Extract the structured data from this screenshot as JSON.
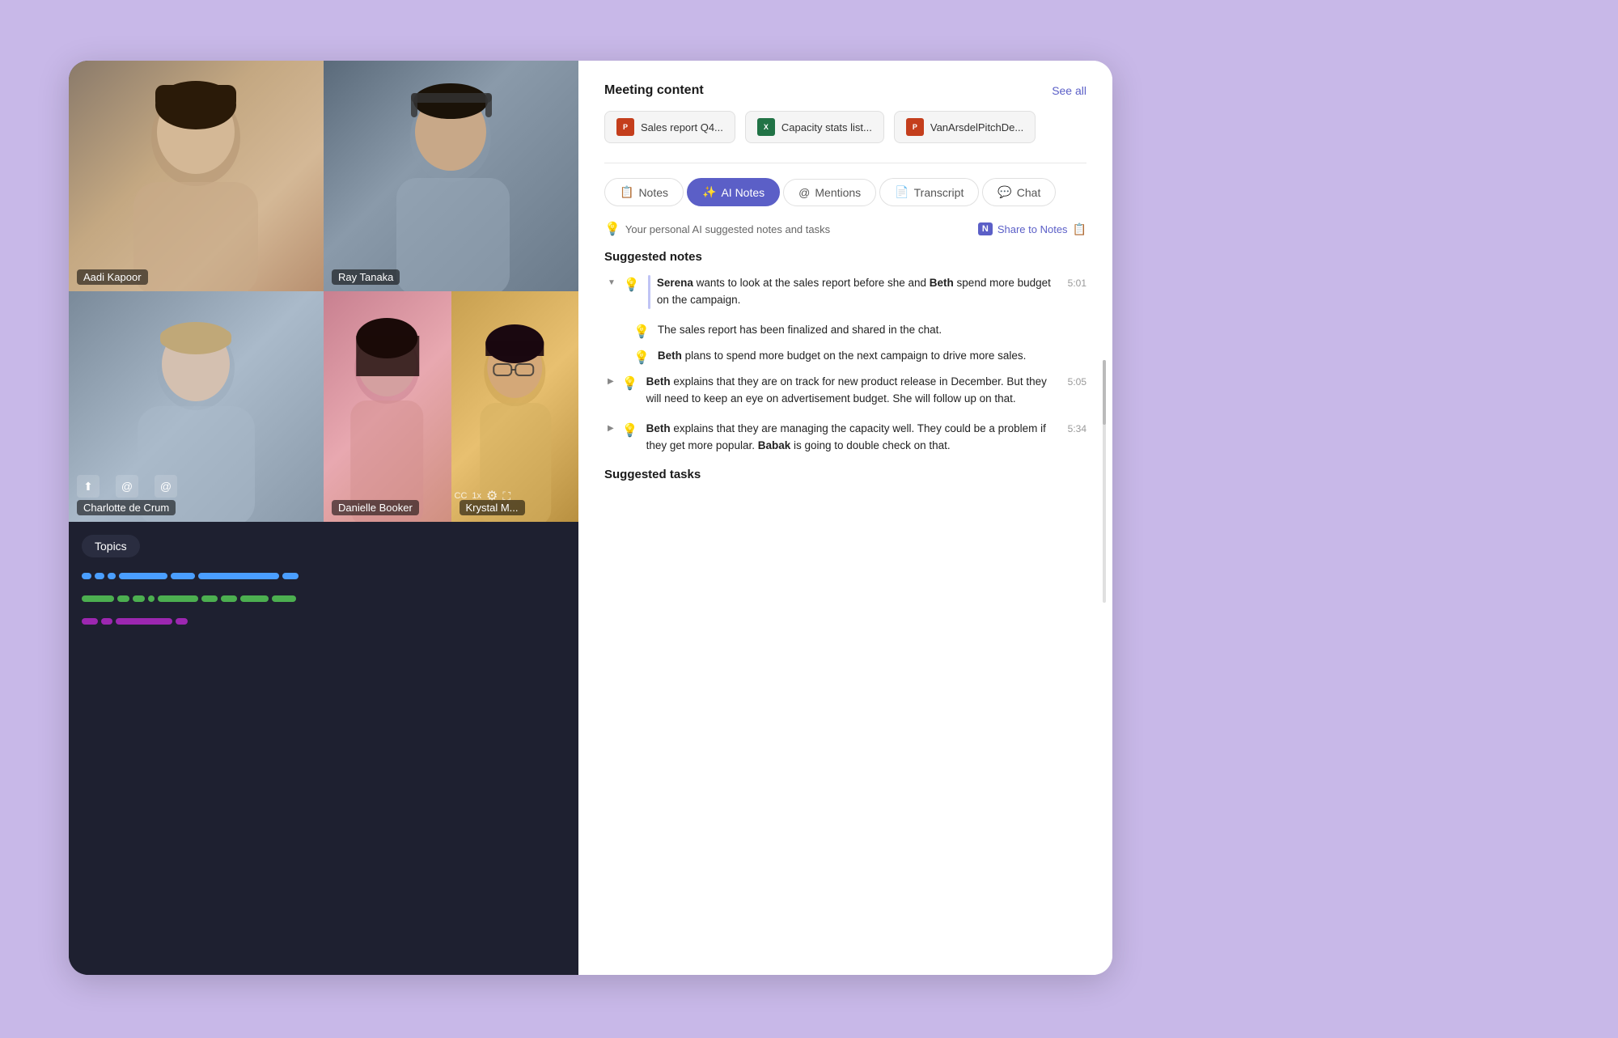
{
  "background": {
    "accent_color": "#c8b8e8"
  },
  "header": {
    "meeting_content_title": "Meeting content",
    "see_all_label": "See all"
  },
  "files": [
    {
      "id": "file-1",
      "icon_type": "ppt",
      "icon_label": "P",
      "name": "Sales report Q4...",
      "color": "#c43e1c"
    },
    {
      "id": "file-2",
      "icon_type": "xls",
      "icon_label": "X",
      "name": "Capacity stats list...",
      "color": "#217346"
    },
    {
      "id": "file-3",
      "icon_type": "ppt",
      "icon_label": "P",
      "name": "VanArsdelPitchDe...",
      "color": "#c43e1c"
    }
  ],
  "tabs": [
    {
      "id": "notes",
      "label": "Notes",
      "icon": "📋",
      "active": false
    },
    {
      "id": "ai-notes",
      "label": "AI Notes",
      "icon": "✨",
      "active": true
    },
    {
      "id": "mentions",
      "label": "Mentions",
      "icon": "@",
      "active": false
    },
    {
      "id": "transcript",
      "label": "Transcript",
      "icon": "📄",
      "active": false
    },
    {
      "id": "chat",
      "label": "Chat",
      "icon": "💬",
      "active": false
    }
  ],
  "ai_notes_panel": {
    "hint_text": "Your personal AI suggested notes and tasks",
    "share_label": "Share to Notes",
    "sections": [
      {
        "id": "suggested-notes",
        "title": "Suggested notes",
        "items": [
          {
            "id": "note-1",
            "expanded": true,
            "has_border": true,
            "text_html": "<strong>Serena</strong> wants to look at the sales report before she and <strong>Beth</strong> spend more budget on the campaign.",
            "time": "5:01",
            "children": [
              {
                "id": "note-1-1",
                "text_html": "The sales report has been finalized and shared in the chat."
              },
              {
                "id": "note-1-2",
                "text_html": "<strong>Beth</strong> plans to spend more budget on the next campaign to drive more sales."
              }
            ]
          },
          {
            "id": "note-2",
            "expanded": false,
            "text_html": "<strong>Beth</strong> explains that they are on track for new product release in December. But they will need to keep an eye on advertisement budget. She will follow up on that.",
            "time": "5:05"
          },
          {
            "id": "note-3",
            "expanded": false,
            "text_html": "<strong>Beth</strong> explains that they are managing the capacity well. They could be a problem if they get more popular. <strong>Babak</strong> is going to double check on that.",
            "time": "5:34"
          }
        ]
      },
      {
        "id": "suggested-tasks",
        "title": "Suggested tasks"
      }
    ]
  },
  "participants": [
    {
      "id": "aadi",
      "name": "Aadi Kapoor",
      "tile": "top-left"
    },
    {
      "id": "ray",
      "name": "Ray Tanaka",
      "tile": "top-right"
    },
    {
      "id": "charlotte",
      "name": "Charlotte de Crum",
      "tile": "bottom-left"
    },
    {
      "id": "danielle",
      "name": "Danielle Booker",
      "tile": "bottom-right-left"
    },
    {
      "id": "krystal",
      "name": "Krystal M...",
      "tile": "bottom-right-right"
    }
  ],
  "topics_label": "Topics",
  "waveforms": [
    {
      "color": "#4a9eff",
      "type": "blue"
    },
    {
      "color": "#4caf50",
      "type": "green"
    },
    {
      "color": "#9c27b0",
      "type": "purple"
    }
  ]
}
